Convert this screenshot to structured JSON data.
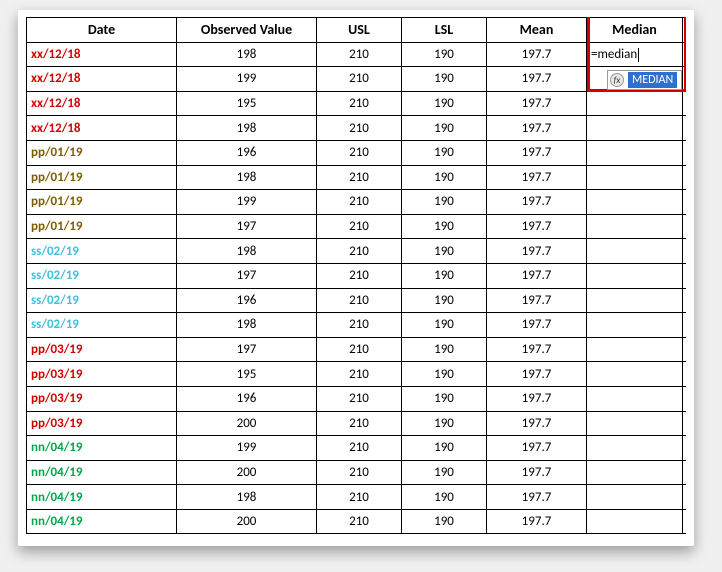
{
  "headers": {
    "date": "Date",
    "observed": "Observed Value",
    "usl": "USL",
    "lsl": "LSL",
    "mean": "Mean",
    "median": "Median"
  },
  "rows": [
    {
      "date": "xx/12/18",
      "color": "date-red",
      "observed": 198,
      "usl": 210,
      "lsl": 190,
      "mean": "197.7",
      "median_formula": "=median"
    },
    {
      "date": "xx/12/18",
      "color": "date-red",
      "observed": 199,
      "usl": 210,
      "lsl": 190,
      "mean": "197.7"
    },
    {
      "date": "xx/12/18",
      "color": "date-red",
      "observed": 195,
      "usl": 210,
      "lsl": 190,
      "mean": "197.7"
    },
    {
      "date": "xx/12/18",
      "color": "date-red",
      "observed": 198,
      "usl": 210,
      "lsl": 190,
      "mean": "197.7"
    },
    {
      "date": "pp/01/19",
      "color": "date-olive",
      "observed": 196,
      "usl": 210,
      "lsl": 190,
      "mean": "197.7"
    },
    {
      "date": "pp/01/19",
      "color": "date-olive",
      "observed": 198,
      "usl": 210,
      "lsl": 190,
      "mean": "197.7"
    },
    {
      "date": "pp/01/19",
      "color": "date-olive",
      "observed": 199,
      "usl": 210,
      "lsl": 190,
      "mean": "197.7"
    },
    {
      "date": "pp/01/19",
      "color": "date-olive",
      "observed": 197,
      "usl": 210,
      "lsl": 190,
      "mean": "197.7"
    },
    {
      "date": "ss/02/19",
      "color": "date-cyan",
      "observed": 198,
      "usl": 210,
      "lsl": 190,
      "mean": "197.7"
    },
    {
      "date": "ss/02/19",
      "color": "date-cyan",
      "observed": 197,
      "usl": 210,
      "lsl": 190,
      "mean": "197.7"
    },
    {
      "date": "ss/02/19",
      "color": "date-cyan",
      "observed": 196,
      "usl": 210,
      "lsl": 190,
      "mean": "197.7"
    },
    {
      "date": "ss/02/19",
      "color": "date-cyan",
      "observed": 198,
      "usl": 210,
      "lsl": 190,
      "mean": "197.7"
    },
    {
      "date": "pp/03/19",
      "color": "date-red",
      "observed": 197,
      "usl": 210,
      "lsl": 190,
      "mean": "197.7"
    },
    {
      "date": "pp/03/19",
      "color": "date-red",
      "observed": 195,
      "usl": 210,
      "lsl": 190,
      "mean": "197.7"
    },
    {
      "date": "pp/03/19",
      "color": "date-red",
      "observed": 196,
      "usl": 210,
      "lsl": 190,
      "mean": "197.7"
    },
    {
      "date": "pp/03/19",
      "color": "date-red",
      "observed": 200,
      "usl": 210,
      "lsl": 190,
      "mean": "197.7"
    },
    {
      "date": "nn/04/19",
      "color": "date-green",
      "observed": 199,
      "usl": 210,
      "lsl": 190,
      "mean": "197.7"
    },
    {
      "date": "nn/04/19",
      "color": "date-green",
      "observed": 200,
      "usl": 210,
      "lsl": 190,
      "mean": "197.7"
    },
    {
      "date": "nn/04/19",
      "color": "date-green",
      "observed": 198,
      "usl": 210,
      "lsl": 190,
      "mean": "197.7"
    },
    {
      "date": "nn/04/19",
      "color": "date-green",
      "observed": 200,
      "usl": 210,
      "lsl": 190,
      "mean": "197.7"
    }
  ],
  "suggestion": {
    "fn_glyph": "fx",
    "label": "MEDIAN"
  }
}
